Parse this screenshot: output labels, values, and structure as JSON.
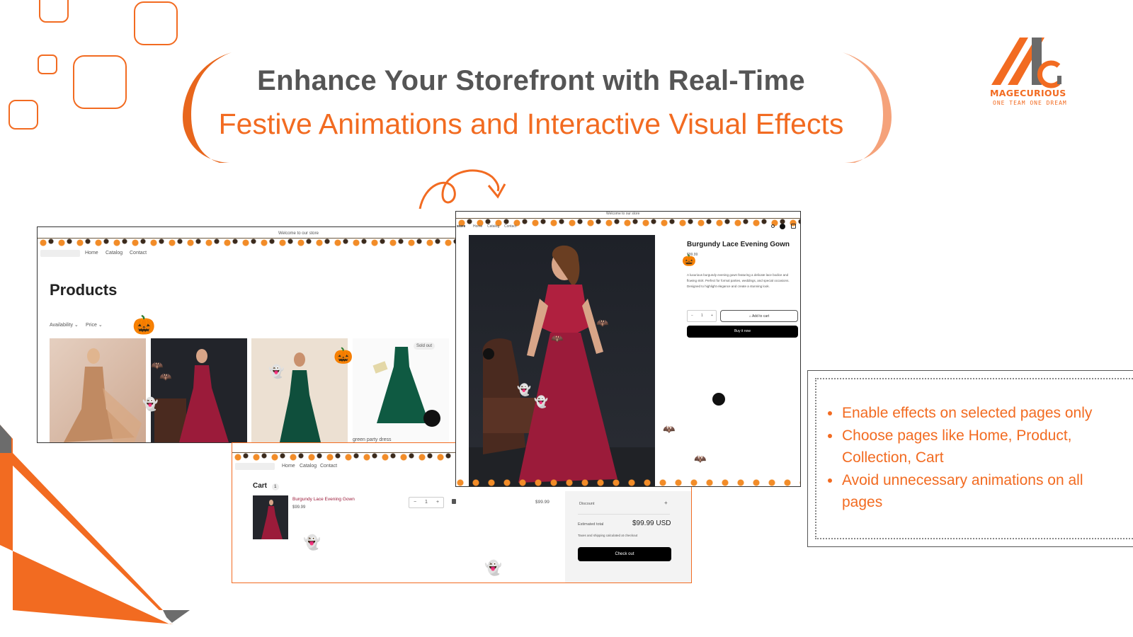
{
  "header": {
    "title_line1": "Enhance Your Storefront with Real-Time",
    "title_line2": "Festive Animations and Interactive Visual Effects"
  },
  "logo": {
    "name": "MAGECURIOUS",
    "tagline": "ONE TEAM ONE DREAM"
  },
  "collection_page": {
    "announcement": "Welcome to our store",
    "nav": [
      "Home",
      "Catalog",
      "Contact"
    ],
    "heading": "Products",
    "filters": [
      "Availability",
      "Price"
    ],
    "sold_out_badge": "Sold out",
    "product_caption": "green party dress"
  },
  "product_page": {
    "announcement": "Welcome to our store",
    "store_label": "store",
    "nav": [
      "Home",
      "Catalog",
      "Contact"
    ],
    "title": "Burgundy Lace Evening Gown",
    "price": "$99.99",
    "description": "A luxurious burgundy evening gown featuring a delicate lace bodice and flowing skirt. Perfect for formal parties, weddings, and special occasions. Designed to highlight elegance and create a stunning look.",
    "quantity": "1",
    "add_to_cart": "Add to cart",
    "buy_now": "Buy it now"
  },
  "cart_page": {
    "nav": [
      "Home",
      "Catalog",
      "Contact"
    ],
    "heading": "Cart",
    "count": "1",
    "item_name": "Burgundy Lace Evening Gown",
    "item_price": "$99.99",
    "quantity": "1",
    "line_total": "$99.99",
    "discount_label": "Discount",
    "estimated_total_label": "Estimated total",
    "estimated_total": "$99.99 USD",
    "tax_note": "Taxes and shipping calculated at checkout",
    "checkout": "Check out"
  },
  "features": {
    "items": [
      "Enable effects on selected pages only",
      "Choose pages like Home, Product, Collection, Cart",
      "Avoid unnecessary animations on all pages"
    ]
  },
  "colors": {
    "accent": "#f26b21",
    "title_gray": "#555555",
    "gown": "#9b1b3a",
    "green_dress": "#0f5a42"
  }
}
